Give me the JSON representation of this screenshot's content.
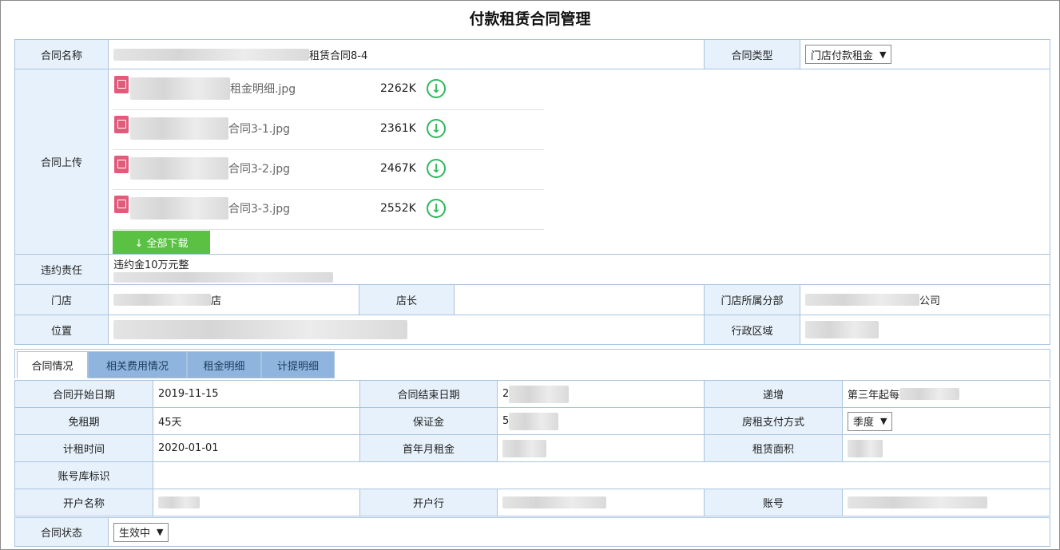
{
  "page": {
    "title": "付款租赁合同管理"
  },
  "contract": {
    "name_label": "合同名称",
    "name_value_suffix": "租赁合同8-4",
    "type_label": "合同类型",
    "type_value": "门店付款租金",
    "upload_label": "合同上传",
    "files": [
      {
        "name_suffix": "租金明细.jpg",
        "size": "2262K"
      },
      {
        "name_suffix": "合同3-1.jpg",
        "size": "2361K"
      },
      {
        "name_suffix": "合同3-2.jpg",
        "size": "2467K"
      },
      {
        "name_suffix": "合同3-3.jpg",
        "size": "2552K"
      }
    ],
    "download_all": "↓ 全部下载",
    "breach_label": "违约责任",
    "breach_value": "违约金10万元整",
    "store_label": "门店",
    "store_value_suffix": "店",
    "manager_label": "店长",
    "branch_label": "门店所属分部",
    "branch_value_suffix": "公司",
    "location_label": "位置",
    "district_label": "行政区域"
  },
  "tabs": [
    {
      "label": "合同情况",
      "active": true
    },
    {
      "label": "相关费用情况",
      "active": false
    },
    {
      "label": "租金明细",
      "active": false
    },
    {
      "label": "计提明细",
      "active": false
    }
  ],
  "details": {
    "start_date_label": "合同开始日期",
    "start_date_value": "2019-11-15",
    "end_date_label": "合同结束日期",
    "end_date_prefix": "2",
    "increase_label": "递增",
    "increase_value": "第三年起每",
    "free_rent_label": "免租期",
    "free_rent_value": "45天",
    "deposit_label": "保证金",
    "deposit_prefix": "5",
    "payment_method_label": "房租支付方式",
    "payment_method_value": "季度",
    "rent_start_label": "计租时间",
    "rent_start_value": "2020-01-01",
    "first_year_rent_label": "首年月租金",
    "area_label": "租赁面积",
    "account_lib_label": "账号库标识",
    "account_name_label": "开户名称",
    "bank_label": "开户行",
    "account_no_label": "账号",
    "status_label": "合同状态",
    "status_value": "生效中"
  },
  "icons": {
    "file": "image-file-icon",
    "download": "download-circle-icon",
    "dropdown": "dropdown-arrow-icon"
  },
  "colors": {
    "label_bg": "#e6f1fb",
    "border": "#a9c4de",
    "tab_inactive": "#8fb4de",
    "download_green": "#2db85b",
    "download_all_bg": "#5ac142",
    "file_icon": "#e25b7a"
  }
}
